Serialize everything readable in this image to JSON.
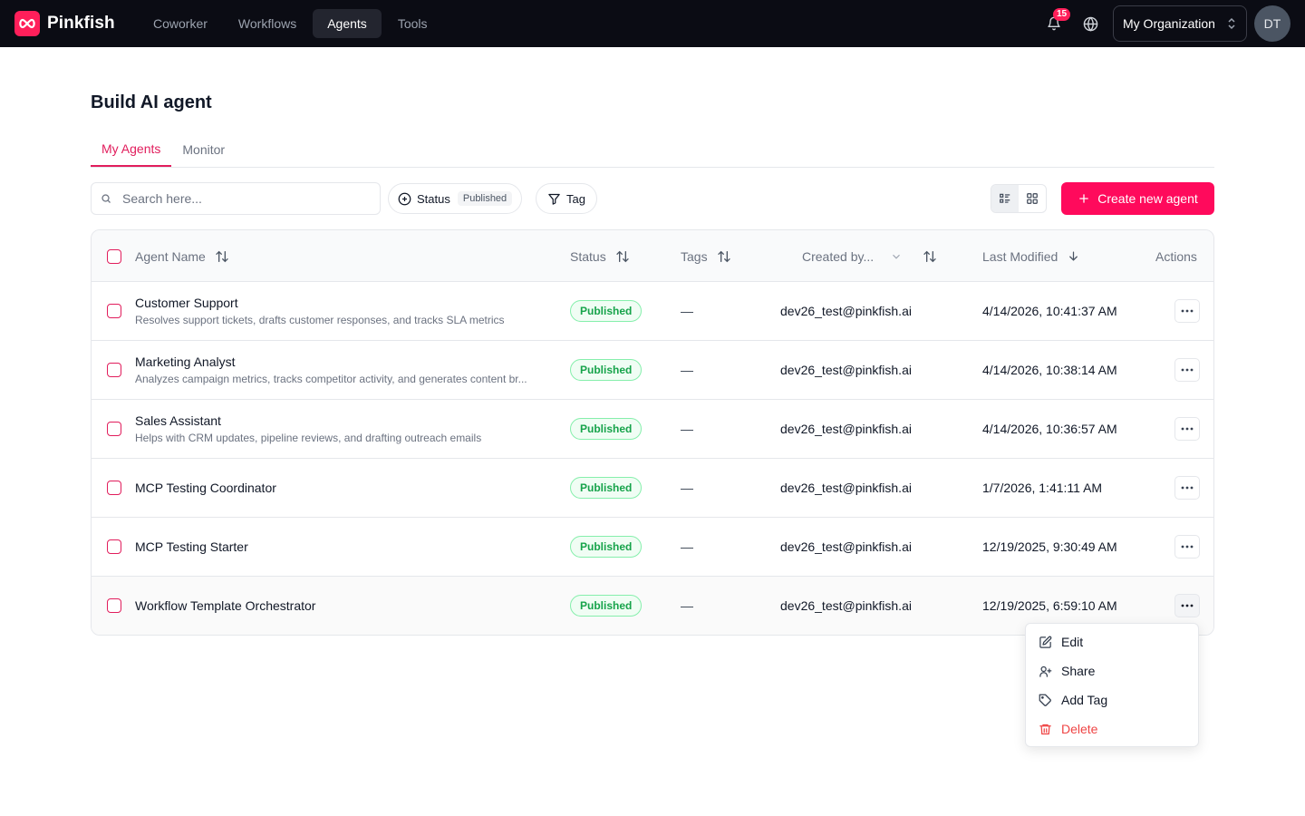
{
  "app": {
    "brand": "Pinkfish",
    "nav": [
      {
        "label": "Coworker"
      },
      {
        "label": "Workflows"
      },
      {
        "label": "Agents"
      },
      {
        "label": "Tools"
      }
    ],
    "notifications_count": "15",
    "org_name": "My Organization",
    "avatar_initials": "DT"
  },
  "page": {
    "title": "Build AI agent",
    "tabs": [
      {
        "label": "My Agents"
      },
      {
        "label": "Monitor"
      }
    ]
  },
  "toolbar": {
    "search_placeholder": "Search here...",
    "status_label": "Status",
    "status_value": "Published",
    "tag_label": "Tag",
    "create_label": "Create new agent"
  },
  "table": {
    "headers": {
      "name": "Agent Name",
      "status": "Status",
      "tags": "Tags",
      "created_by": "Created by...",
      "last_modified": "Last Modified",
      "actions": "Actions"
    },
    "rows": [
      {
        "name": "Customer Support",
        "description": "Resolves support tickets, drafts customer responses, and tracks SLA metrics",
        "status": "Published",
        "tags": "—",
        "created_by": "dev26_test@pinkfish.ai",
        "modified": "4/14/2026, 10:41:37 AM"
      },
      {
        "name": "Marketing Analyst",
        "description": "Analyzes campaign metrics, tracks competitor activity, and generates content br...",
        "status": "Published",
        "tags": "—",
        "created_by": "dev26_test@pinkfish.ai",
        "modified": "4/14/2026, 10:38:14 AM"
      },
      {
        "name": "Sales Assistant",
        "description": "Helps with CRM updates, pipeline reviews, and drafting outreach emails",
        "status": "Published",
        "tags": "—",
        "created_by": "dev26_test@pinkfish.ai",
        "modified": "4/14/2026, 10:36:57 AM"
      },
      {
        "name": "MCP Testing Coordinator",
        "description": "",
        "status": "Published",
        "tags": "—",
        "created_by": "dev26_test@pinkfish.ai",
        "modified": "1/7/2026, 1:41:11 AM"
      },
      {
        "name": "MCP Testing Starter",
        "description": "",
        "status": "Published",
        "tags": "—",
        "created_by": "dev26_test@pinkfish.ai",
        "modified": "12/19/2025, 9:30:49 AM"
      },
      {
        "name": "Workflow Template Orchestrator",
        "description": "",
        "status": "Published",
        "tags": "—",
        "created_by": "dev26_test@pinkfish.ai",
        "modified": "12/19/2025, 6:59:10 AM"
      }
    ]
  },
  "actions_menu": {
    "items": [
      {
        "label": "Edit",
        "icon": "edit-icon"
      },
      {
        "label": "Share",
        "icon": "share-user-icon"
      },
      {
        "label": "Add Tag",
        "icon": "tag-icon"
      },
      {
        "label": "Delete",
        "icon": "trash-icon"
      }
    ]
  },
  "colors": {
    "accent": "#ff0a5c",
    "topbar": "#0b0c14",
    "published": "#16a34a"
  }
}
